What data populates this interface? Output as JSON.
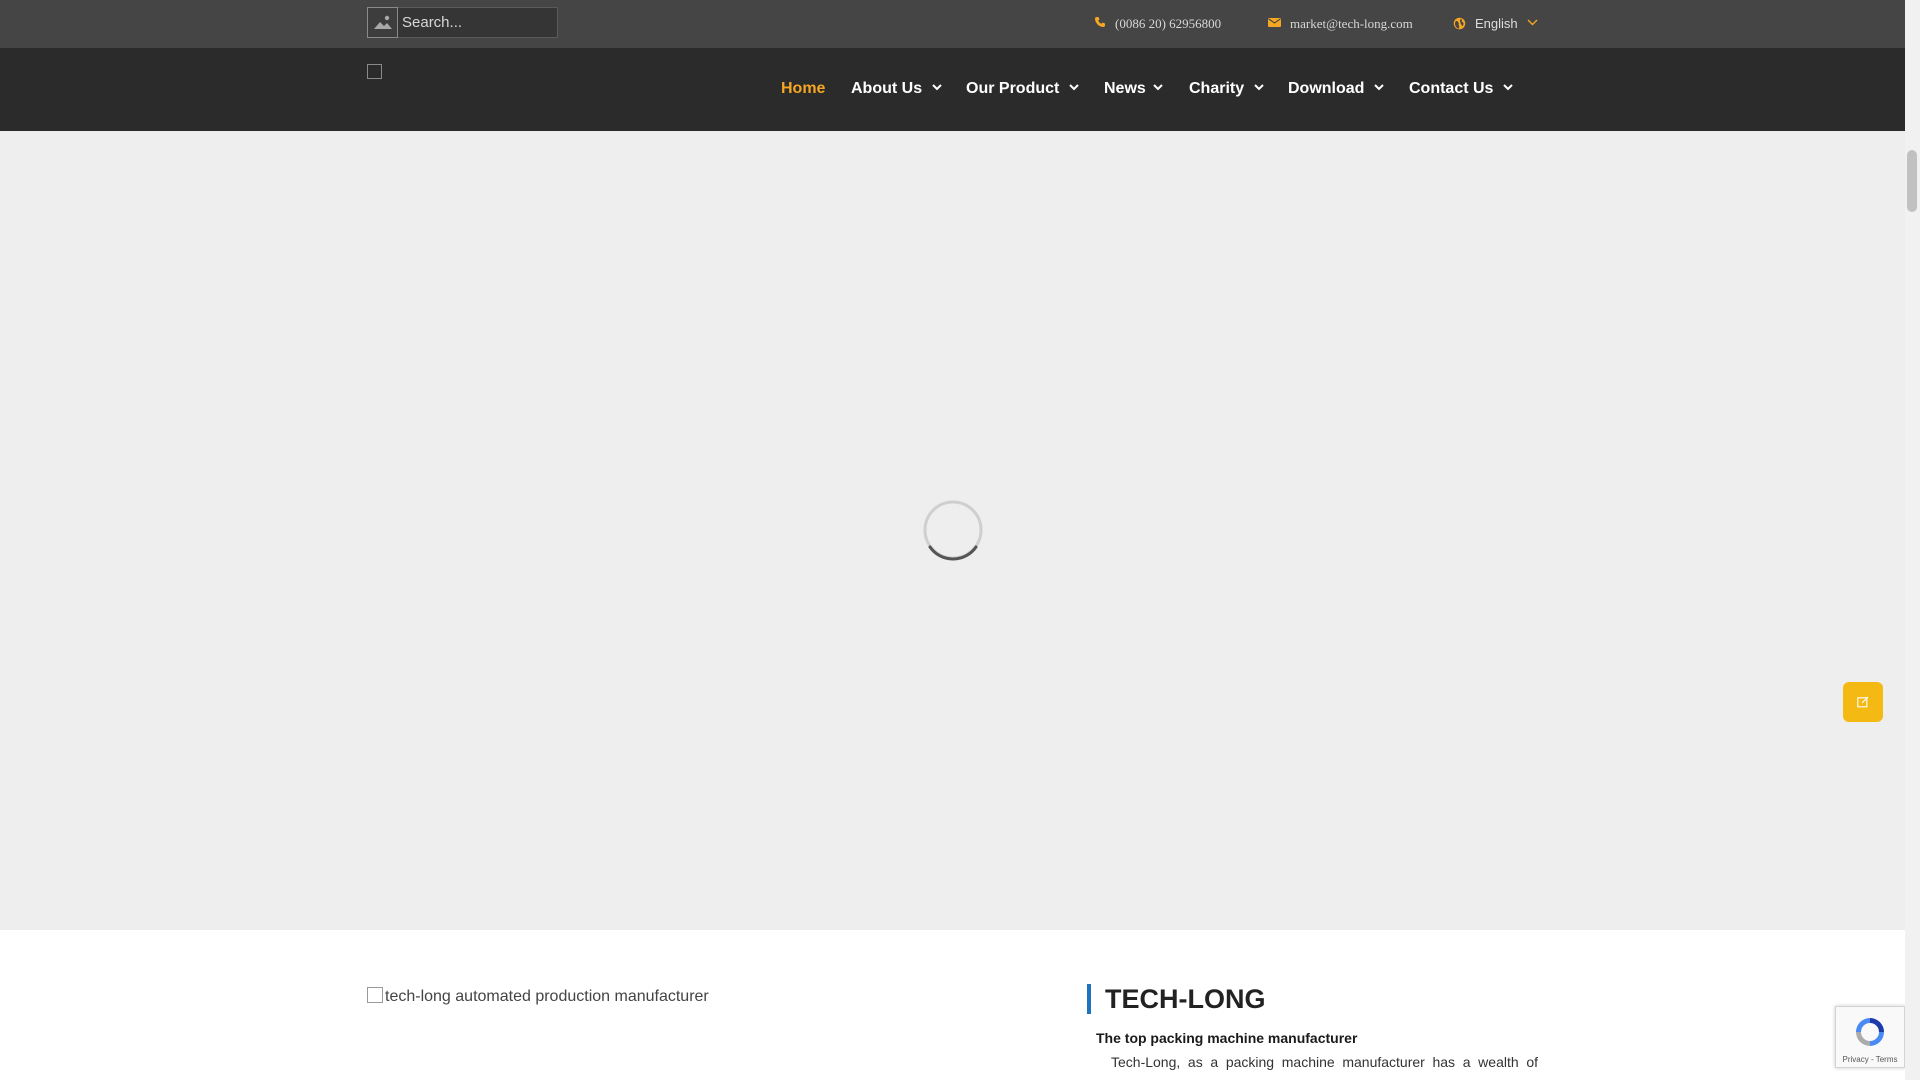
{
  "colors": {
    "accent": "#f5a623",
    "topbar": "#454545",
    "navbar": "#2b2b2b",
    "title_bar": "#1e73be",
    "float_button": "#f5b914"
  },
  "topbar": {
    "search": {
      "placeholder": "Search...",
      "icon": "search-icon"
    },
    "phone": {
      "icon": "phone-icon",
      "text": "(0086 20) 62956800"
    },
    "email": {
      "icon": "mail-icon",
      "text": "market@tech-long.com"
    },
    "language": {
      "icon": "globe-icon",
      "label": "English"
    }
  },
  "nav": {
    "items": [
      {
        "label": "Home",
        "active": true
      },
      {
        "label": "About Us"
      },
      {
        "label": "Our Product"
      },
      {
        "label": "News"
      },
      {
        "label": "Charity"
      },
      {
        "label": "Download"
      },
      {
        "label": "Contact Us"
      }
    ]
  },
  "about": {
    "image_alt": "tech-long automated production manufacturer",
    "title": "TECH-LONG",
    "subtitle": "The top packing machine manufacturer",
    "body": "Tech-Long, as a packing machine manufacturer has a wealth of"
  },
  "recaptcha": {
    "terms": "Privacy - Terms"
  }
}
